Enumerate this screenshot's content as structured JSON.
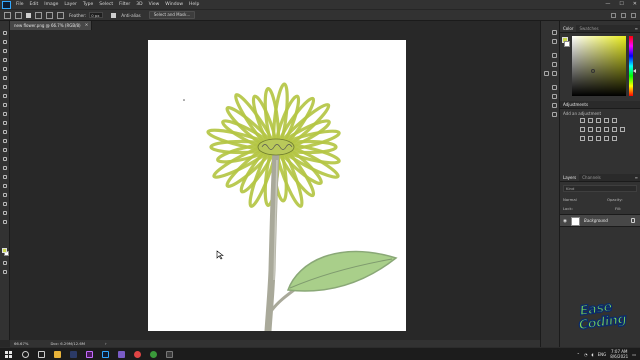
{
  "app": {
    "name": "Photoshop",
    "brand_color": "#31a8ff"
  },
  "menu": {
    "items": [
      "File",
      "Edit",
      "Image",
      "Layer",
      "Type",
      "Select",
      "Filter",
      "3D",
      "View",
      "Window",
      "Help"
    ]
  },
  "window_controls": {
    "minimize": "—",
    "maximize": "☐",
    "close": "✕"
  },
  "options": {
    "feather_label": "Feather:",
    "feather_value": "0 px",
    "antialias_label": "Anti-alias",
    "select_mask_label": "Select and Mask..."
  },
  "document": {
    "tab_title": "new flower.png @ 66.7% (RGB/8)",
    "close": "×"
  },
  "status": {
    "zoom": "66.67%",
    "doc_size": "Doc: 6.29M/12.6M",
    "arrow": "›"
  },
  "panels": {
    "color_tab": "Color",
    "swatches_tab": "Swatches",
    "adjustments_title": "Adjustments",
    "add_adjustment": "Add an adjustment",
    "layers_tab": "Layers",
    "channels_tab": "Channels",
    "menu_icon": "≡",
    "kind_filter": "Kind",
    "blend_mode": "Normal",
    "opacity_label": "Opacity:",
    "lock_label": "Lock:",
    "fill_label": "Fill:"
  },
  "layers": [
    {
      "name": "Background",
      "visible": true,
      "locked": true
    }
  ],
  "colors": {
    "foreground": "#c7d54b",
    "background": "#ffffff",
    "petal_stroke": "#b4c644",
    "stem": "#a9a99a",
    "leaf": "#a9cf8a"
  },
  "logo": {
    "line1": "Ease",
    "line2": "Coding"
  },
  "taskbar": {
    "language": "ENG",
    "time": "7:07 AM",
    "date": "8/6/2021"
  },
  "icons": {
    "eye": "eye-icon",
    "lock": "lock-icon",
    "start": "windows-start-icon"
  }
}
